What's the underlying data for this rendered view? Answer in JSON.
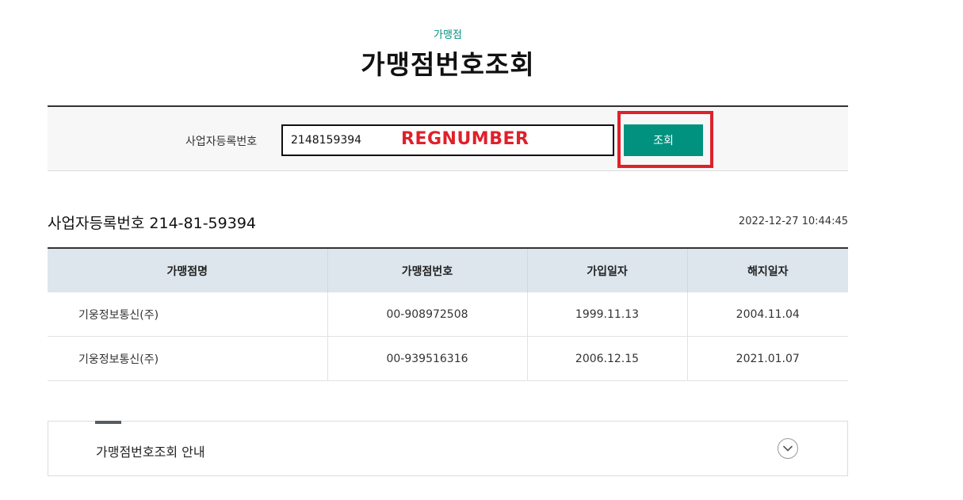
{
  "header": {
    "category": "가맹점",
    "title": "가맹점번호조회"
  },
  "search": {
    "label": "사업자등록번호",
    "value": "2148159394",
    "overlay_label": "REGNUMBER",
    "button_label": "조회"
  },
  "result": {
    "heading": "사업자등록번호 214-81-59394",
    "timestamp": "2022-12-27 10:44:45",
    "columns": [
      "가맹점명",
      "가맹점번호",
      "가입일자",
      "해지일자"
    ],
    "rows": [
      [
        "기웅정보통신(주)",
        "00-908972508",
        "1999.11.13",
        "2004.11.04"
      ],
      [
        "기웅정보통신(주)",
        "00-939516316",
        "2006.12.15",
        "2021.01.07"
      ]
    ]
  },
  "info": {
    "title": "가맹점번호조회 안내",
    "toggle_icon": "chevron-down-icon"
  },
  "colors": {
    "accent": "#00927f",
    "highlight": "#e0202a",
    "table_header": "#dce6ec"
  }
}
